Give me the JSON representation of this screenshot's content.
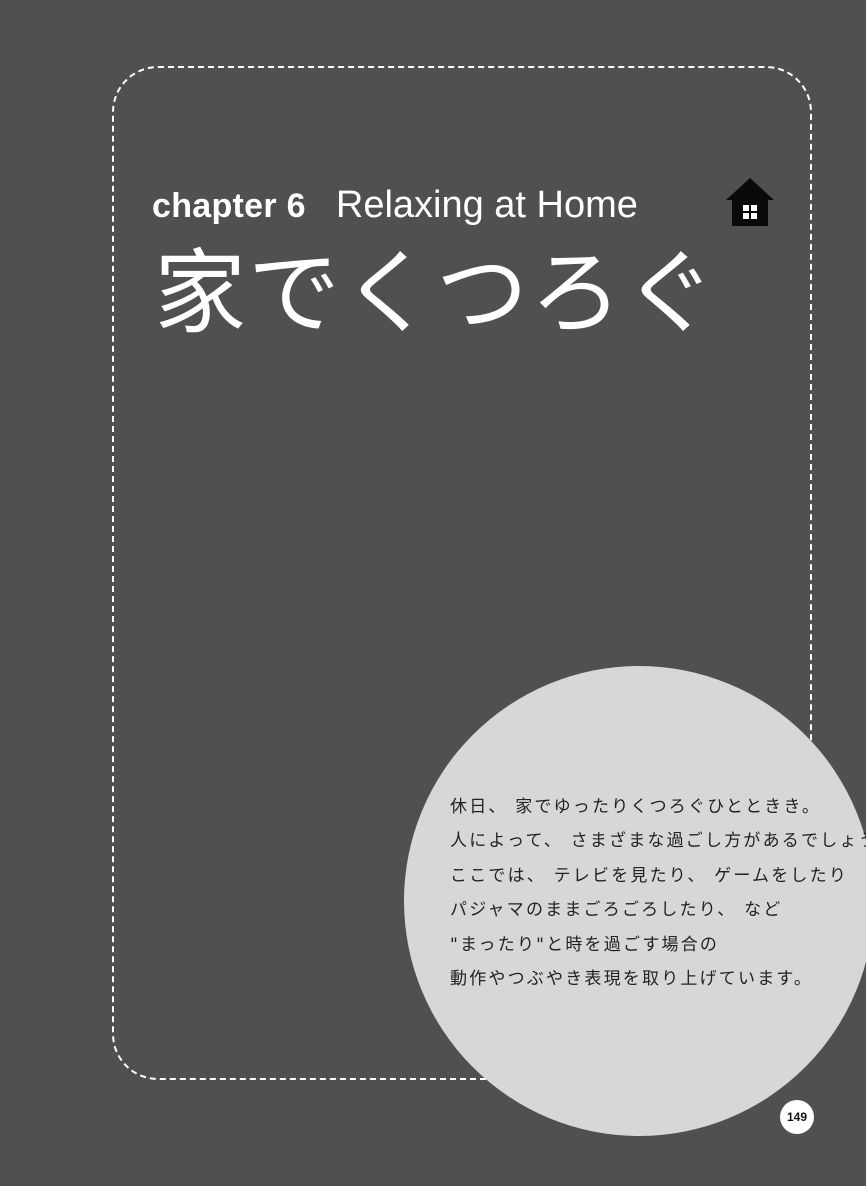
{
  "header": {
    "chapter_label": "chapter 6",
    "chapter_subtitle": "Relaxing at Home",
    "title": "家でくつろぐ",
    "icon": "house-icon"
  },
  "intro": {
    "lines": [
      "休日、 家でゆったりくつろぐひとときき。",
      "人によって、 さまざまな過ごし方があるでしょう。",
      "ここでは、 テレビを見たり、 ゲームをしたり",
      "パジャマのままごろごろしたり、 など",
      "\"まったり\"と時を過ごす場合の",
      "動作やつぶやき表現を取り上げています。"
    ]
  },
  "footer": {
    "page_number": "149"
  },
  "colors": {
    "background": "#505050",
    "frame": "#ffffff",
    "circle": "#d7d7d7",
    "text_light": "#ffffff",
    "text_dark": "#222222"
  }
}
